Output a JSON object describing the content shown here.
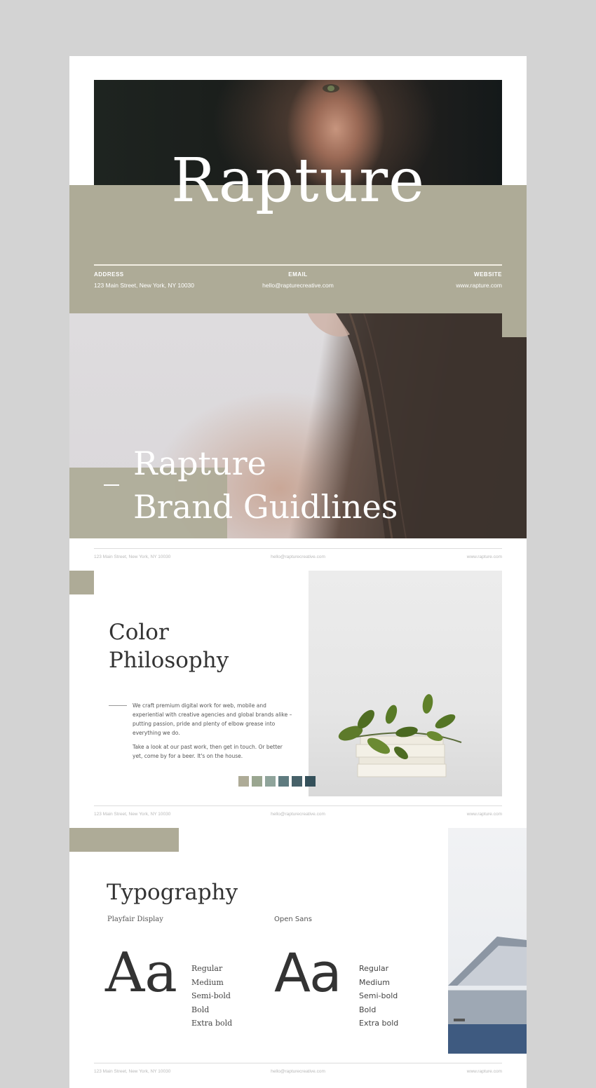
{
  "cover": {
    "title": "Rapture",
    "address_label": "ADDRESS",
    "address": "123 Main Street, New York, NY 10030",
    "email_label": "EMAIL",
    "email": "hello@rapturecreative.com",
    "website_label": "WEBSITE",
    "website": "www.rapture.com"
  },
  "hero": {
    "title_line1": "Rapture",
    "title_line2": "Brand Guidlines"
  },
  "footer": {
    "address": "123 Main Street, New York, NY 10030",
    "email": "hello@rapturecreative.com",
    "website": "www.rapture.com"
  },
  "color_philosophy": {
    "title_line1": "Color",
    "title_line2": "Philosophy",
    "paragraph1": "We craft premium digital work for web, mobile and experiential with creative agencies and global brands alike – putting passion, pride and plenty of elbow grease into everything we do.",
    "paragraph2": "Take a look at our past work, then get in touch. Or better yet, come by for a beer. It's on the house.",
    "swatches": [
      "#aeab97",
      "#9aa690",
      "#8fa49b",
      "#5f7b7f",
      "#476169",
      "#34505a"
    ]
  },
  "typography": {
    "title": "Typography",
    "serif_font": "Playfair Display",
    "sans_font": "Open Sans",
    "sample": "Aa",
    "weights": [
      "Regular",
      "Medium",
      "Semi-bold",
      "Bold",
      "Extra bold"
    ]
  },
  "colors": {
    "accent": "#aeab97",
    "canvas": "#d3d3d3"
  }
}
